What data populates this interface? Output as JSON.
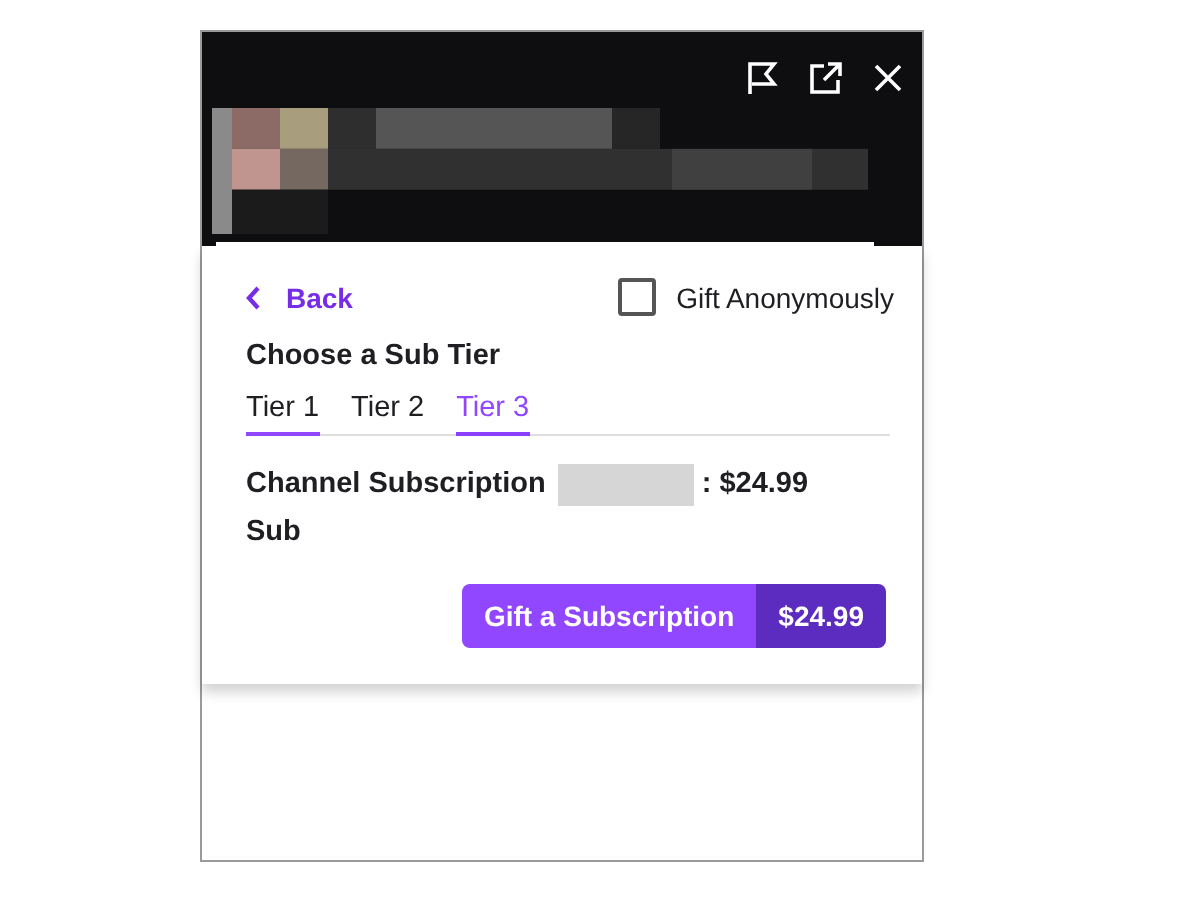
{
  "header": {
    "buttons": [
      {
        "kind": "flag"
      },
      {
        "kind": "popout"
      },
      {
        "kind": "close"
      }
    ]
  },
  "back": {
    "label": "Back"
  },
  "gift_anonymously": {
    "label": "Gift Anonymously",
    "checked": false
  },
  "heading": "Choose a Sub Tier",
  "tabs": [
    {
      "label": "Tier 1",
      "selected": false,
      "hovered": true
    },
    {
      "label": "Tier 2",
      "selected": false,
      "hovered": false
    },
    {
      "label": "Tier 3",
      "selected": true,
      "hovered": false
    }
  ],
  "subscription": {
    "label": "Channel Subscription",
    "redacted": true,
    "price": ": $24.99",
    "second_line": "Sub"
  },
  "gift_button": {
    "label": "Gift a Subscription",
    "price": "$24.99"
  }
}
